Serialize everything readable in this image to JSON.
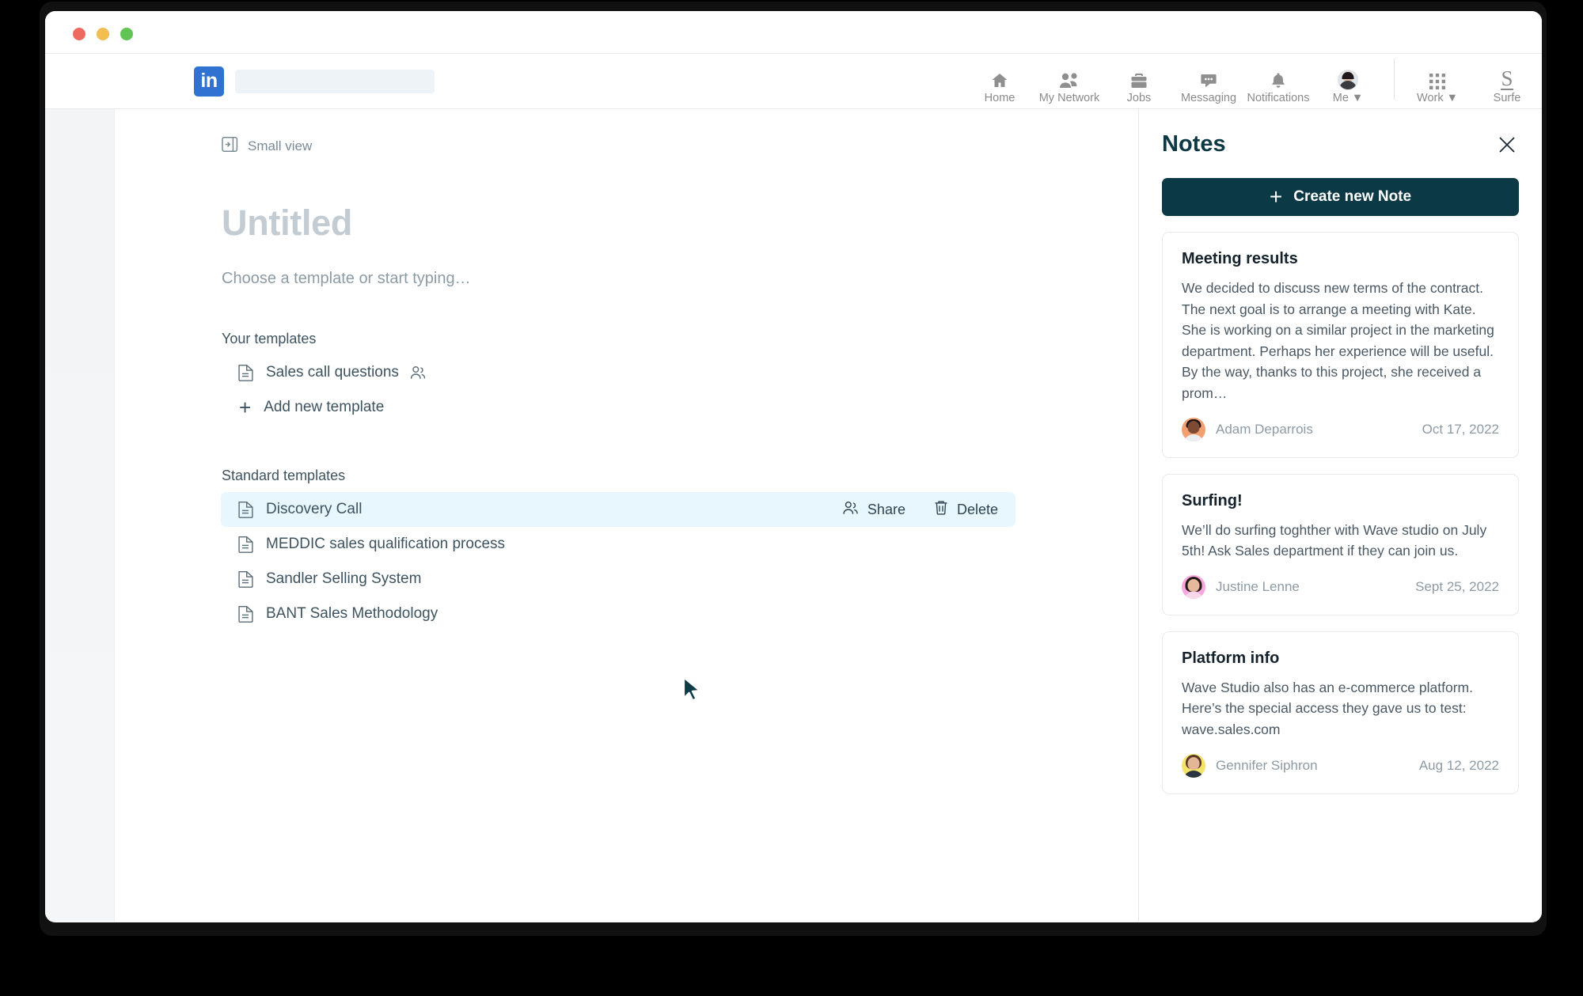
{
  "window": {
    "traffic_lights": [
      "close",
      "minimize",
      "maximize"
    ]
  },
  "nav": {
    "logo_text": "in",
    "search_placeholder": "",
    "search_value": "",
    "items": [
      {
        "label": "Home",
        "icon": "home-icon"
      },
      {
        "label": "My Network",
        "icon": "people-icon"
      },
      {
        "label": "Jobs",
        "icon": "briefcase-icon"
      },
      {
        "label": "Messaging",
        "icon": "message-bubble-icon"
      },
      {
        "label": "Notifications",
        "icon": "bell-icon"
      },
      {
        "label": "Me ▼",
        "icon": "avatar-icon"
      }
    ],
    "right_items": [
      {
        "label": "Work ▼",
        "icon": "grid-apps-icon"
      },
      {
        "label": "Surfe",
        "icon": "surfe-logo-icon"
      }
    ]
  },
  "document": {
    "small_view_label": "Small view",
    "small_view_icon": "panel-collapse-icon",
    "title": "Untitled",
    "subtitle": "Choose a template or start typing…",
    "your_templates_label": "Your templates",
    "your_templates": [
      {
        "name": "Sales call questions",
        "icon": "document-icon",
        "shared": true,
        "shared_icon": "people-icon"
      }
    ],
    "add_new_template_label": "Add new template",
    "add_new_template_icon": "plus-icon",
    "standard_templates_label": "Standard templates",
    "standard_templates": [
      {
        "name": "Discovery Call",
        "icon": "document-icon",
        "highlighted": true
      },
      {
        "name": "MEDDIC sales qualification process",
        "icon": "document-icon",
        "highlighted": false
      },
      {
        "name": "Sandler Selling System",
        "icon": "document-icon",
        "highlighted": false
      },
      {
        "name": "BANT Sales Methodology",
        "icon": "document-icon",
        "highlighted": false
      }
    ],
    "row_actions": {
      "share_label": "Share",
      "share_icon": "people-icon",
      "delete_label": "Delete",
      "delete_icon": "trash-icon"
    }
  },
  "notes": {
    "title": "Notes",
    "close_icon": "close-icon",
    "create_label": "Create new Note",
    "create_icon": "plus-icon",
    "cards": [
      {
        "title": "Meeting results",
        "body": "We decided to discuss new terms of the contract. The next goal is to arrange a meeting with Kate. She is working on a similar project in the marketing department. Perhaps her experience will be useful. By the way, thanks to this project, she received a prom…",
        "author": "Adam Deparrois",
        "date": "Oct 17, 2022"
      },
      {
        "title": "Surfing!",
        "body": "We’ll do surfing toghther with Wave studio on July 5th! Ask Sales department if they can join us.",
        "author": "Justine Lenne",
        "date": "Sept 25, 2022"
      },
      {
        "title": "Platform info",
        "body": "Wave Studio also has an e-commerce platform. Here’s the special access they gave us to test: wave.sales.com",
        "author": "Gennifer Siphron",
        "date": "Aug 12, 2022"
      }
    ]
  },
  "colors": {
    "brand_dark": "#0c3946",
    "linkedin_blue": "#2f72d1",
    "row_highlight": "#e7f7fd",
    "cursor": "#0d3b48"
  }
}
